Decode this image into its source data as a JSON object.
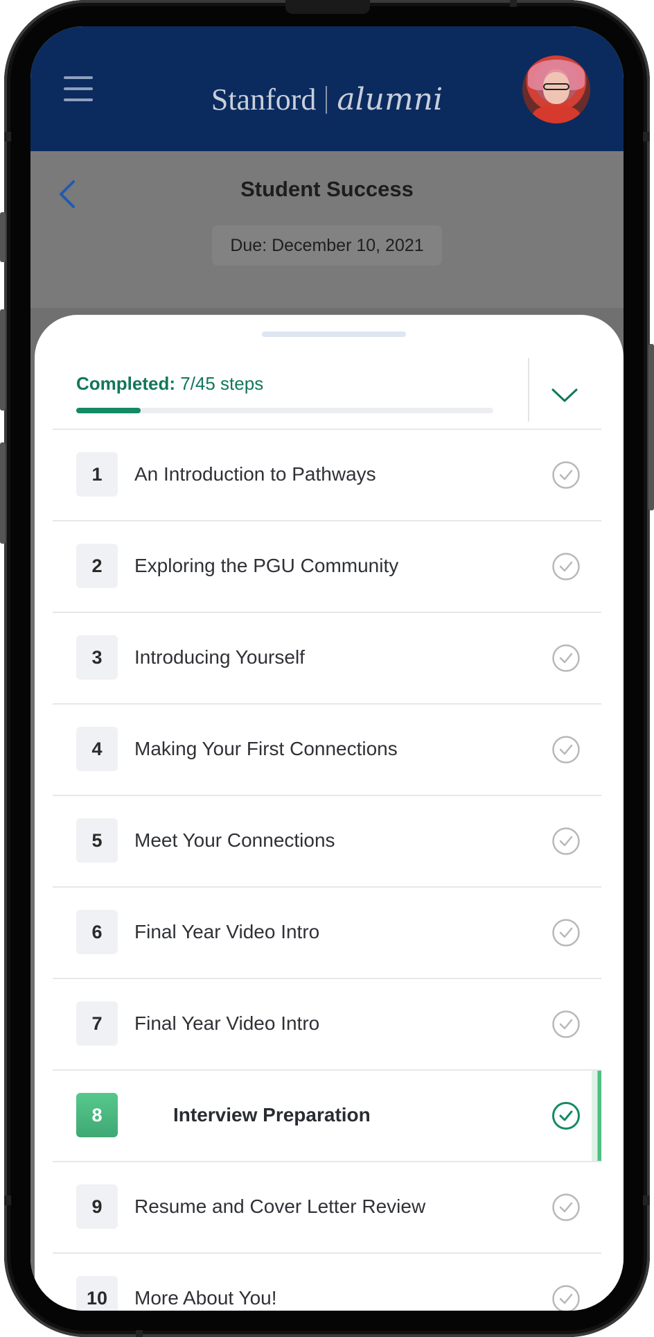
{
  "header": {
    "brand_name": "Stanford",
    "brand_sub": "alumni"
  },
  "page": {
    "title": "Student Success",
    "due": "Due: December 10, 2021"
  },
  "progress": {
    "label": "Completed:",
    "value": "7/45 steps",
    "fraction": 0.155
  },
  "steps": [
    {
      "number": "1",
      "title": "An Introduction to Pathways"
    },
    {
      "number": "2",
      "title": "Exploring the PGU Community"
    },
    {
      "number": "3",
      "title": "Introducing Yourself"
    },
    {
      "number": "4",
      "title": "Making Your First Connections"
    },
    {
      "number": "5",
      "title": "Meet Your Connections"
    },
    {
      "number": "6",
      "title": "Final Year Video Intro"
    },
    {
      "number": "7",
      "title": "Final Year Video Intro"
    },
    {
      "number": "8",
      "title": "Interview Preparation"
    },
    {
      "number": "9",
      "title": "Resume and Cover Letter Review"
    },
    {
      "number": "10",
      "title": "More About You!"
    }
  ],
  "colors": {
    "header_bg": "#0b2b5f",
    "accent_green": "#138a63",
    "active_green": "#4fbf84",
    "check_grey": "#b8b8b8"
  },
  "icons": {
    "menu": "hamburger-icon",
    "back": "chevron-left-icon",
    "collapse": "chevron-down-icon",
    "step_status": "check-circle-icon"
  }
}
